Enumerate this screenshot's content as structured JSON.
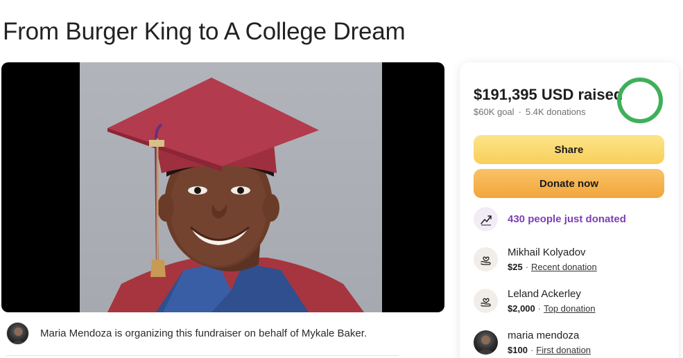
{
  "page": {
    "title": "From Burger King to A College Dream"
  },
  "organizer": {
    "text": "Maria Mendoza is organizing this fundraiser on behalf of Mykale Baker."
  },
  "summary": {
    "amount": "$191,395",
    "unit": "USD raised",
    "goal": "$60K goal",
    "donations": "5.4K donations",
    "progress_fraction": 1.0,
    "ring_color": "#3fb05a"
  },
  "buttons": {
    "share": "Share",
    "donate": "Donate now"
  },
  "recent_activity": {
    "text": "430 people just donated"
  },
  "donors": [
    {
      "name": "Mikhail Kolyadov",
      "amount": "$25",
      "tag": "Recent donation",
      "icon": "heart-hand-icon"
    },
    {
      "name": "Leland Ackerley",
      "amount": "$2,000",
      "tag": "Top donation",
      "icon": "heart-hand-icon"
    },
    {
      "name": "maria mendoza",
      "amount": "$100",
      "tag": "First donation",
      "icon": "avatar"
    }
  ],
  "colors": {
    "share": "#f7cf5a",
    "donate": "#f2a53c",
    "accent_purple": "#7b3fb5",
    "progress_green": "#3fb05a"
  }
}
